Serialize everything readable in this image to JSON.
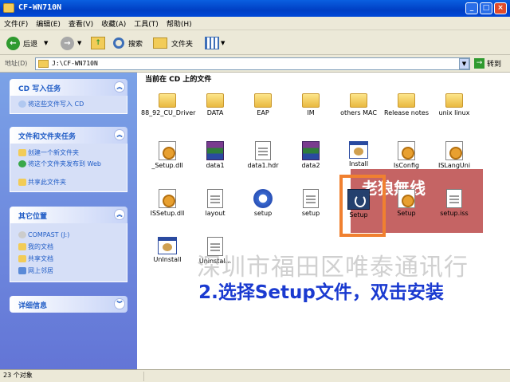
{
  "window": {
    "title": "CF-WN710N"
  },
  "menubar": [
    "文件(F)",
    "编辑(E)",
    "查看(V)",
    "收藏(A)",
    "工具(T)",
    "帮助(H)"
  ],
  "toolbar": {
    "back": "后退",
    "search": "搜索",
    "folders": "文件夹"
  },
  "address": {
    "label": "地址(D)",
    "value": "J:\\CF-WN710N",
    "go": "转到"
  },
  "tasks": {
    "cd_title": "CD 写入任务",
    "cd_items": [
      "将这些文件写入 CD"
    ],
    "file_title": "文件和文件夹任务",
    "file_items": [
      "创建一个新文件夹",
      "将这个文件夹发布到 Web",
      "共享此文件夹"
    ],
    "other_title": "其它位置",
    "other_items": [
      "COMPAST (J:)",
      "我的文档",
      "共享文档",
      "网上邻居"
    ],
    "details_title": "详细信息"
  },
  "content": {
    "title": "当前在 CD 上的文件",
    "files": [
      {
        "name": "88_92_CU_Driver",
        "icon": "folder"
      },
      {
        "name": "DATA",
        "icon": "folder"
      },
      {
        "name": "EAP",
        "icon": "folder"
      },
      {
        "name": "IM",
        "icon": "folder"
      },
      {
        "name": "others MAC",
        "icon": "folder"
      },
      {
        "name": "Release notes",
        "icon": "folder"
      },
      {
        "name": "unix linux",
        "icon": "folder"
      },
      {
        "name": "_Setup.dll",
        "icon": "dll"
      },
      {
        "name": "data1",
        "icon": "rar"
      },
      {
        "name": "data1.hdr",
        "icon": "doc"
      },
      {
        "name": "data2",
        "icon": "rar"
      },
      {
        "name": "Install",
        "icon": "exe"
      },
      {
        "name": "IsConfig",
        "icon": "gear"
      },
      {
        "name": "ISLangUni",
        "icon": "gear"
      },
      {
        "name": "ISSetup.dll",
        "icon": "dll"
      },
      {
        "name": "layout",
        "icon": "doc"
      },
      {
        "name": "setup",
        "icon": "ani"
      },
      {
        "name": "setup",
        "icon": "doc"
      },
      {
        "name": "Setup",
        "icon": "setup"
      },
      {
        "name": "Setup",
        "icon": "gear"
      },
      {
        "name": "setup.iss",
        "icon": "doc"
      },
      {
        "name": "UnInstall",
        "icon": "exe"
      },
      {
        "name": "Uninstal...",
        "icon": "doc"
      }
    ],
    "caption": "2.选择Setup文件，双击安装",
    "watermark_center": "深圳市福田区唯泰通讯行",
    "watermark_logo": "老狼無线"
  },
  "status": {
    "text": "23 个对象"
  }
}
